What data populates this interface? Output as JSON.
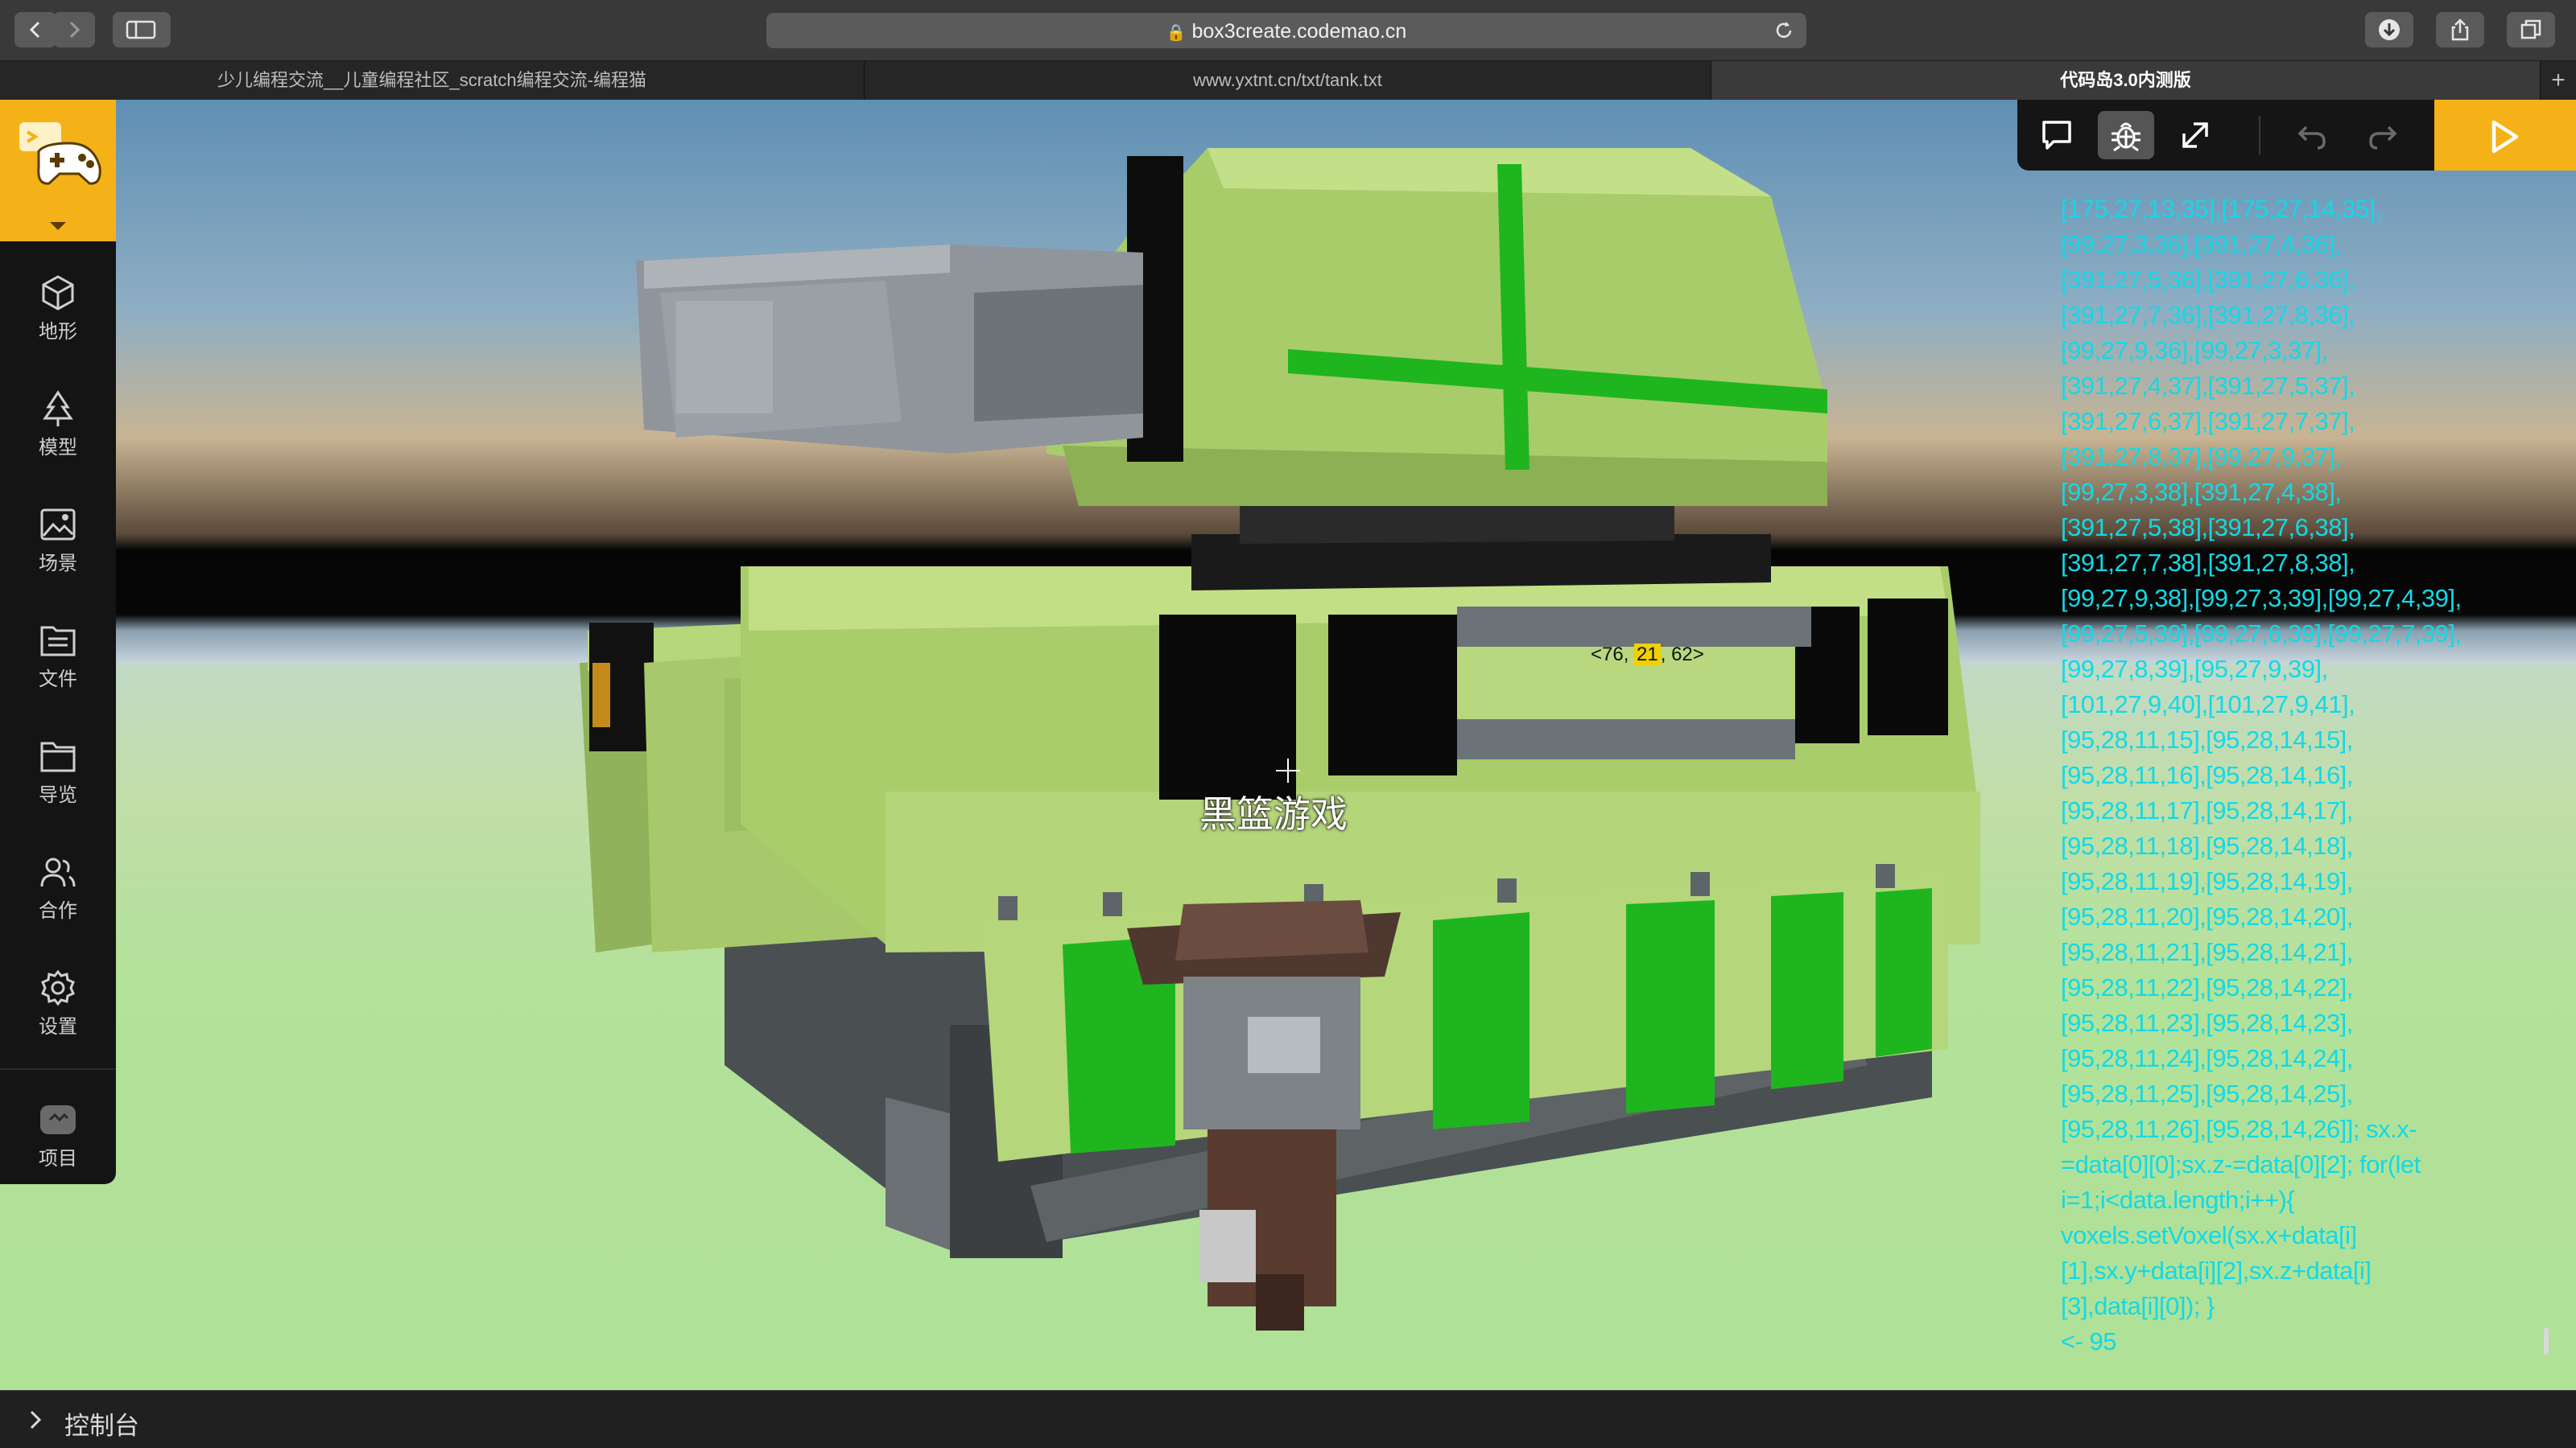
{
  "browser": {
    "url": "box3create.codemao.cn",
    "tabs": [
      {
        "label": "少儿编程交流__儿童编程社区_scratch编程交流-编程猫"
      },
      {
        "label": "www.yxtnt.cn/txt/tank.txt"
      },
      {
        "label": "代码岛3.0内测版"
      }
    ]
  },
  "sidebar": {
    "items": [
      {
        "label": "地形",
        "icon": "cube-icon"
      },
      {
        "label": "模型",
        "icon": "tree-icon"
      },
      {
        "label": "场景",
        "icon": "image-icon"
      },
      {
        "label": "文件",
        "icon": "file-list-icon"
      },
      {
        "label": "导览",
        "icon": "folder-icon"
      },
      {
        "label": "合作",
        "icon": "users-icon"
      },
      {
        "label": "设置",
        "icon": "gear-icon"
      },
      {
        "label": "项目",
        "icon": "project-icon"
      }
    ]
  },
  "scene": {
    "coords_before": "<76, ",
    "coords_highlight": "21",
    "coords_after": ", 62>",
    "player_name": "黑篮游戏"
  },
  "console": {
    "lines": [
      "[175,27,13,35],[175,27,14,35],",
      "[99,27,3,36],[391,27,4,36],",
      "[391,27,5,36],[391,27,6,36],",
      "[391,27,7,36],[391,27,8,36],",
      "[99,27,9,36],[99,27,3,37],",
      "[391,27,4,37],[391,27,5,37],",
      "[391,27,6,37],[391,27,7,37],",
      "[391,27,8,37],[99,27,9,37],",
      "[99,27,3,38],[391,27,4,38],",
      "[391,27,5,38],[391,27,6,38],",
      "[391,27,7,38],[391,27,8,38],",
      "[99,27,9,38],[99,27,3,39],[99,27,4,39],",
      "[99,27,5,39],[99,27,6,39],[99,27,7,39],",
      "[99,27,8,39],[95,27,9,39],",
      "[101,27,9,40],[101,27,9,41],",
      "[95,28,11,15],[95,28,14,15],",
      "[95,28,11,16],[95,28,14,16],",
      "[95,28,11,17],[95,28,14,17],",
      "[95,28,11,18],[95,28,14,18],",
      "[95,28,11,19],[95,28,14,19],",
      "[95,28,11,20],[95,28,14,20],",
      "[95,28,11,21],[95,28,14,21],",
      "[95,28,11,22],[95,28,14,22],",
      "[95,28,11,23],[95,28,14,23],",
      "[95,28,11,24],[95,28,14,24],",
      "[95,28,11,25],[95,28,14,25],",
      "[95,28,11,26],[95,28,14,26]]; sx.x-",
      "=data[0][0];sx.z-=data[0][2]; for(let",
      "i=1;i<data.length;i++){",
      "voxels.setVoxel(sx.x+data[i]",
      "[1],sx.y+data[i][2],sx.z+data[i]",
      "[3],data[i][0]); }",
      "<- 95"
    ],
    "bar_label": "控制台"
  },
  "colors": {
    "accent": "#f5b218",
    "console_text": "#12d9e6",
    "tank_green": "#a9cc6a",
    "tank_stripe": "#1fb51f",
    "ground": "#b2e29a"
  }
}
